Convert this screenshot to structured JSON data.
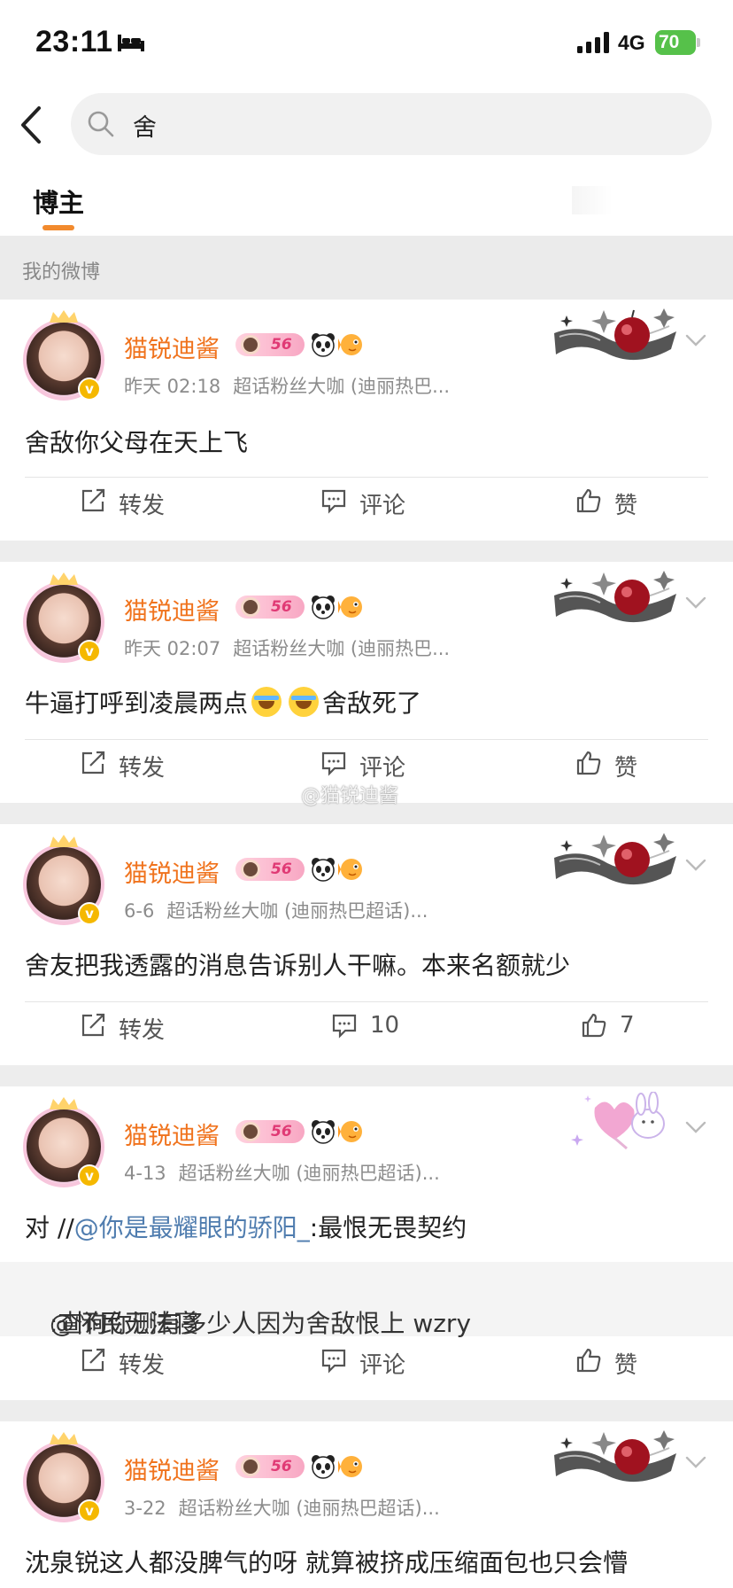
{
  "status_bar": {
    "time": "23:11",
    "network": "4G",
    "battery": "70"
  },
  "search": {
    "query": "舍"
  },
  "tabs": [
    {
      "label": "博主"
    }
  ],
  "section": {
    "title": "我的微博"
  },
  "watermark": "@猫锐迪酱",
  "posts": [
    {
      "user": "猫锐迪酱",
      "level": "56",
      "time": "昨天 02:18",
      "source": "超话粉丝大咖 (迪丽热巴...",
      "text": "舍敌你父母在天上飞",
      "actions": {
        "repost": "转发",
        "comment": "评论",
        "like": "赞"
      }
    },
    {
      "user": "猫锐迪酱",
      "level": "56",
      "time": "昨天 02:07",
      "source": "超话粉丝大咖 (迪丽热巴...",
      "text_before": "牛逼打呼到凌晨两点",
      "text_after": "舍敌死了",
      "emoji": "laughing-tears",
      "actions": {
        "repost": "转发",
        "comment": "评论",
        "like": "赞"
      }
    },
    {
      "user": "猫锐迪酱",
      "level": "56",
      "time": "6-6",
      "source": "超话粉丝大咖 (迪丽热巴超话)...",
      "text": "舍友把我透露的消息告诉别人干嘛。本来名额就少",
      "actions": {
        "repost": "转发",
        "comment": "10",
        "like": "7"
      }
    },
    {
      "user": "猫锐迪酱",
      "level": "56",
      "time": "4-13",
      "source": "超话粉丝大咖 (迪丽热巴超话)...",
      "text_prefix": "对 //",
      "mention": "@你是最耀眼的骄阳_",
      "text_suffix": ":最恨无畏契约",
      "repost": {
        "mention": "@怀民无法寝",
        "text": ":查询你测有多少人因为舍敌恨上 wzry"
      },
      "actions": {
        "repost": "转发",
        "comment": "评论",
        "like": "赞"
      }
    },
    {
      "user": "猫锐迪酱",
      "level": "56",
      "time": "3-22",
      "source": "超话粉丝大咖 (迪丽热巴超话)...",
      "text": "沈泉锐这人都没脾气的呀 就算被挤成压缩面包也只会懵"
    }
  ],
  "colors": {
    "accent": "#f28a2d",
    "username": "#f0731d",
    "mention": "#507daf",
    "battery": "#56c14a"
  }
}
